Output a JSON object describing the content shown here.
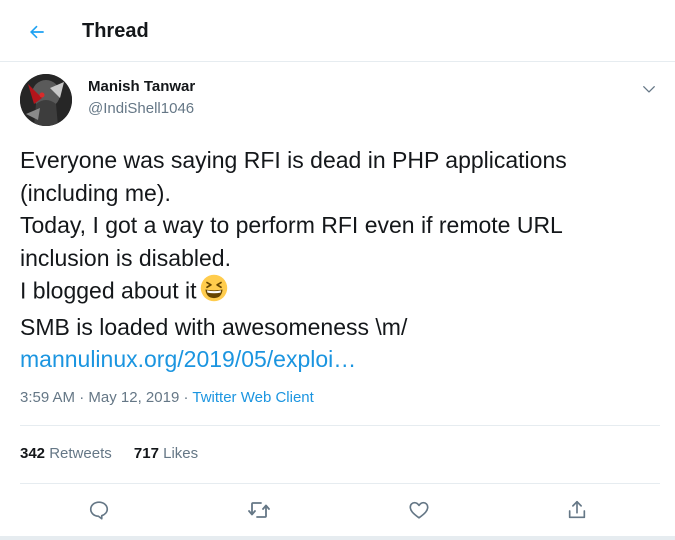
{
  "header": {
    "title": "Thread",
    "back_icon": "arrow-left-icon",
    "accent_color": "#1da1f2"
  },
  "tweet": {
    "author": {
      "name": "Manish Tanwar",
      "handle": "@IndiShell1046"
    },
    "text_lines": [
      "Everyone was saying RFI is dead in PHP applications",
      "(including me).",
      "Today, I got a way to perform RFI even if remote URL",
      "inclusion is disabled.",
      "I blogged about it",
      "SMB is loaded with awesomeness \\m/"
    ],
    "emoji": "grinning-squinting-face-emoji",
    "link": "mannulinux.org/2019/05/exploi…",
    "link_color": "#1b95e0",
    "time": "3:59 AM",
    "date": "May 12, 2019",
    "separator": "·",
    "client": "Twitter Web Client",
    "stats": {
      "retweets_count": "342",
      "retweets_label": "Retweets",
      "likes_count": "717",
      "likes_label": "Likes"
    },
    "actions": [
      "reply-icon",
      "retweet-icon",
      "like-icon",
      "share-icon"
    ]
  }
}
